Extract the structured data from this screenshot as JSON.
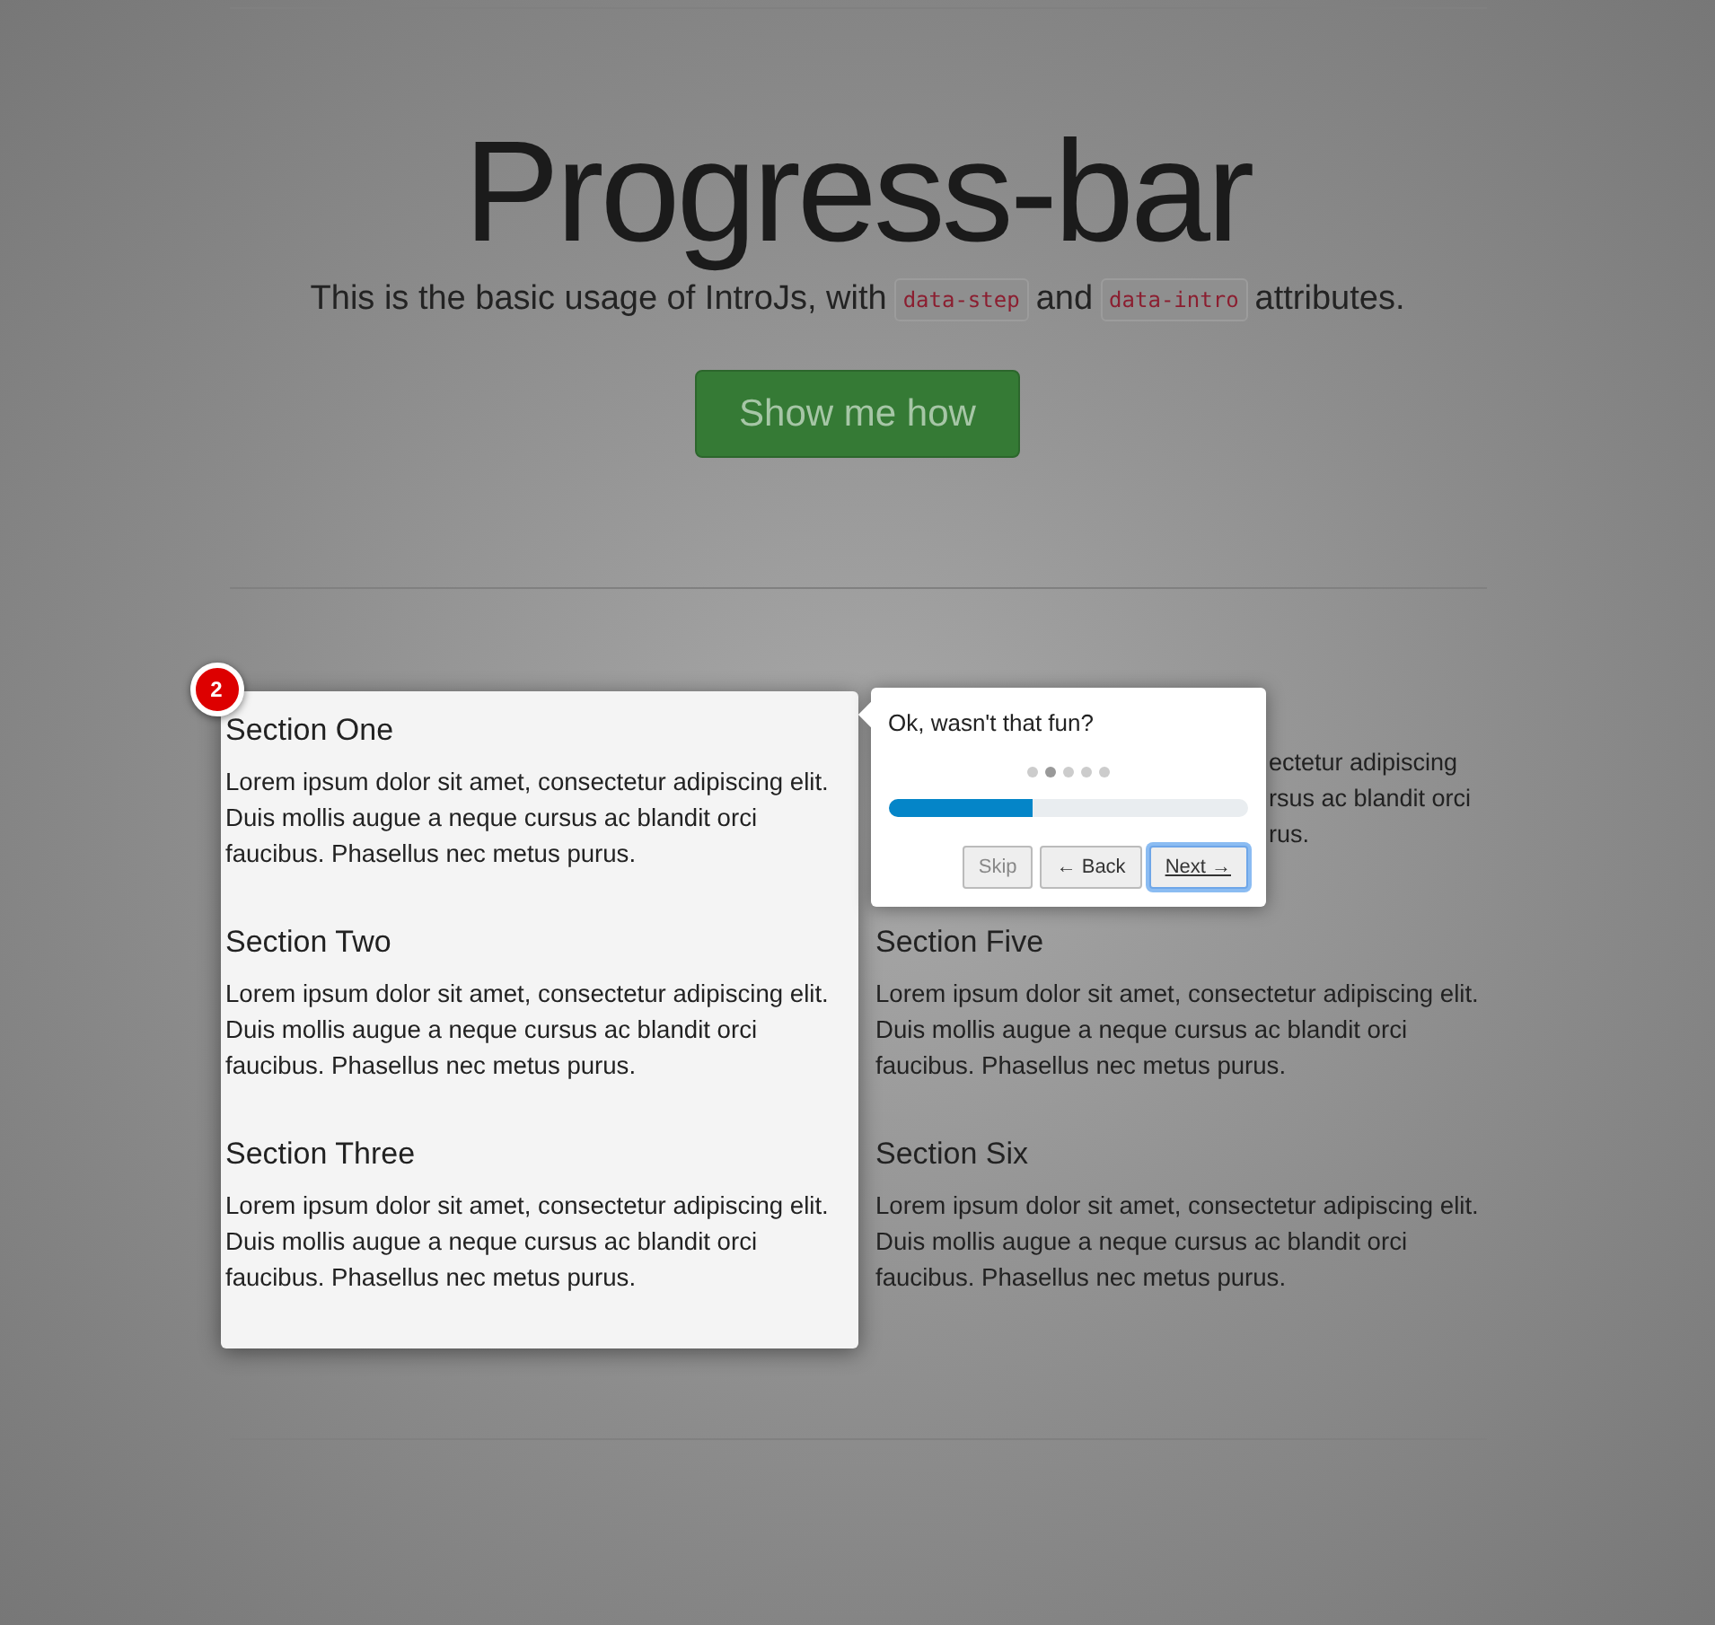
{
  "header": {
    "title": "Progress-bar",
    "lead": [
      {
        "kind": "text",
        "text": "This is the basic usage of IntroJs, with"
      },
      {
        "kind": "code",
        "text": "data-step"
      },
      {
        "kind": "text",
        "text": "and"
      },
      {
        "kind": "code",
        "text": "data-intro"
      },
      {
        "kind": "text",
        "text": "attributes."
      }
    ],
    "button": "Show me how"
  },
  "highlight": {
    "step": "2"
  },
  "left_sections": [
    {
      "title": "Section One",
      "body": "Lorem ipsum dolor sit amet, consectetur adipiscing elit. Duis mollis augue a neque cursus ac blandit orci faucibus. Phasellus nec metus purus."
    },
    {
      "title": "Section Two",
      "body": "Lorem ipsum dolor sit amet, consectetur adipiscing elit. Duis mollis augue a neque cursus ac blandit orci faucibus. Phasellus nec metus purus."
    },
    {
      "title": "Section Three",
      "body": "Lorem ipsum dolor sit amet, consectetur adipiscing elit. Duis mollis augue a neque cursus ac blandit orci faucibus. Phasellus nec metus purus."
    }
  ],
  "right_sections": [
    {
      "kind": "partial",
      "lines": [
        "ectetur adipiscing",
        "rsus ac blandit orci",
        "rus."
      ]
    },
    {
      "kind": "full",
      "title": "Section Five",
      "body": "Lorem ipsum dolor sit amet, consectetur adipiscing elit. Duis mollis augue a neque cursus ac blandit orci faucibus. Phasellus nec metus purus."
    },
    {
      "kind": "full",
      "title": "Section Six",
      "body": "Lorem ipsum dolor sit amet, consectetur adipiscing elit. Duis mollis augue a neque cursus ac blandit orci faucibus. Phasellus nec metus purus."
    }
  ],
  "tooltip": {
    "text": "Ok, wasn't that fun?",
    "bullets": [
      {
        "selected": false
      },
      {
        "selected": true
      },
      {
        "selected": false
      },
      {
        "selected": false
      },
      {
        "selected": false
      }
    ],
    "progress": {
      "level": 0.4
    },
    "buttons": [
      {
        "kind": "skip",
        "label": "Skip",
        "focused": false
      },
      {
        "kind": "back",
        "label": "← Back",
        "focused": false
      },
      {
        "kind": "next",
        "label": "Next →",
        "focused": true
      }
    ]
  }
}
